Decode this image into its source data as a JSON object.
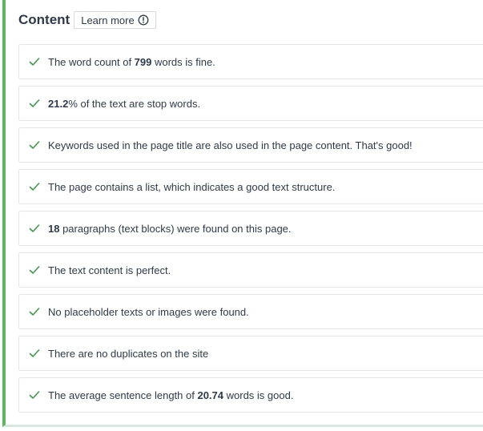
{
  "section": {
    "title": "Content",
    "learn_more_label": "Learn more",
    "accent_color": "#5cb85c",
    "check_color": "#3e9b49",
    "info_icon": "info-circle-icon",
    "check_icon": "checkmark-icon"
  },
  "items": [
    {
      "pre": "The word count of ",
      "bold": "799",
      "post": " words is fine."
    },
    {
      "pre": "",
      "bold": "21.2",
      "post": "% of the text are stop words."
    },
    {
      "pre": "Keywords used in the page title are also used in the page content. That's good!",
      "bold": "",
      "post": ""
    },
    {
      "pre": "The page contains a list, which indicates a good text structure.",
      "bold": "",
      "post": ""
    },
    {
      "pre": "",
      "bold": "18",
      "post": " paragraphs (text blocks) were found on this page."
    },
    {
      "pre": "The text content is perfect.",
      "bold": "",
      "post": ""
    },
    {
      "pre": "No placeholder texts or images were found.",
      "bold": "",
      "post": ""
    },
    {
      "pre": "There are no duplicates on the site",
      "bold": "",
      "post": ""
    },
    {
      "pre": "The average sentence length of ",
      "bold": "20.74",
      "post": " words is good."
    }
  ]
}
